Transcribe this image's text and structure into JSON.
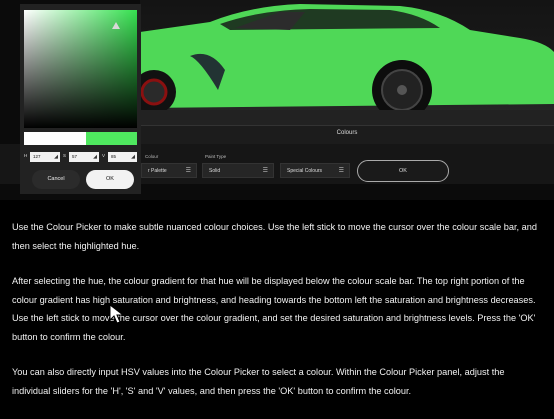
{
  "game": {
    "colours_title": "Colours",
    "colour_label": "Colour",
    "paint_type_label": "Paint Type",
    "colour_value": "r Palette",
    "paint_type_value": "Solid",
    "special_colours": "Special Colours",
    "ok_label": "OK"
  },
  "picker": {
    "h_label": "H",
    "h_value": "127",
    "s_label": "S",
    "s_value": "57",
    "v_label": "V",
    "v_value": "85",
    "cancel_label": "Cancel",
    "ok_label": "OK",
    "selected_hue_color": "#4fe85f",
    "car_color": "#4fd857"
  },
  "description": {
    "p1": "Use the Colour Picker to make subtle nuanced colour choices. Use the left stick to move the cursor over the colour scale bar, and then select the highlighted hue.",
    "p2": "After selecting the hue, the colour gradient for that hue will be displayed below the colour scale bar. The top right portion of the colour gradient has high saturation and brightness, and heading towards the bottom left the saturation and brightness decreases. Use the left stick to move the cursor over the colour gradient, and set the desired saturation and brightness levels. Press the 'OK' button to confirm the colour.",
    "p3": "You can also directly input HSV values into the Colour Picker to select a colour. Within the Colour Picker panel, adjust the individual sliders for the 'H', 'S' and 'V' values, and then press the 'OK' button to confirm the colour."
  }
}
